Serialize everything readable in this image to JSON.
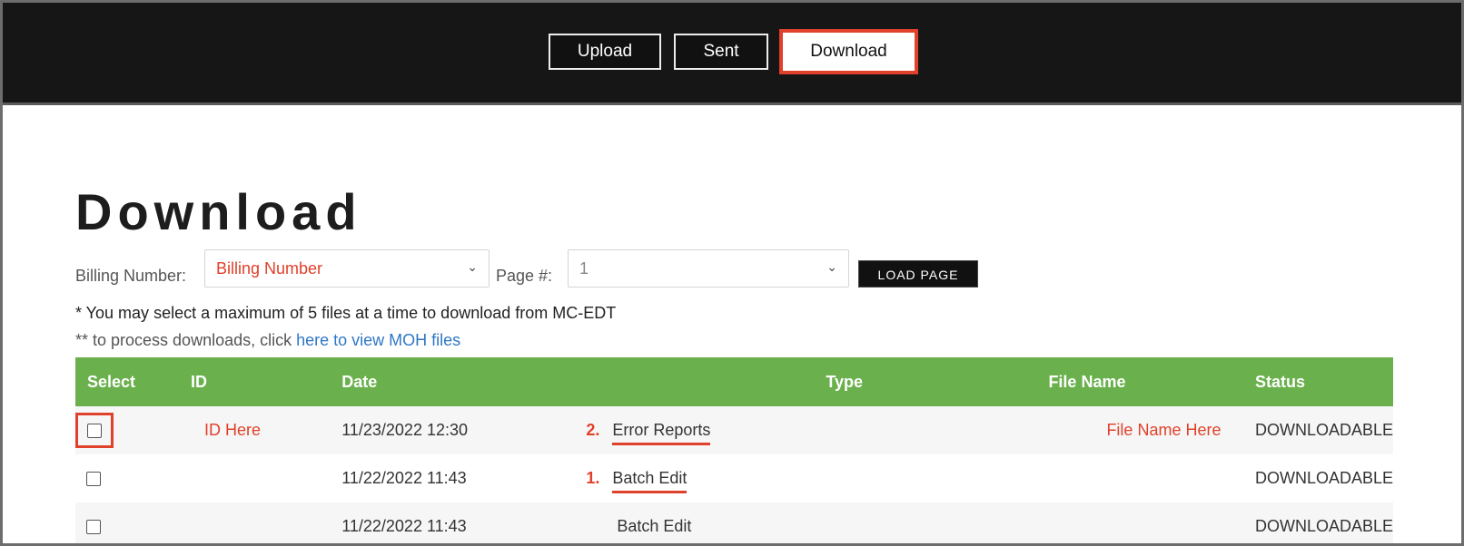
{
  "nav": {
    "upload": "Upload",
    "sent": "Sent",
    "download": "Download"
  },
  "page": {
    "title": "Download",
    "billing_label": "Billing Number:",
    "billing_value": "Billing Number",
    "page_label": "Page #:",
    "page_value": "1",
    "load_button": "LOAD PAGE",
    "note1": "* You may select a maximum of 5 files at a time to download from MC-EDT",
    "note2_prefix": "** to process downloads, click ",
    "note2_link": "here to view MOH files"
  },
  "table": {
    "headers": [
      "Select",
      "ID",
      "Date",
      "Type",
      "File Name",
      "Status"
    ],
    "rows": [
      {
        "id": "ID Here",
        "date": "11/23/2022 12:30",
        "step": "2.",
        "type": "Error Reports",
        "file": "File Name Here",
        "status": "DOWNLOADABLE"
      },
      {
        "id": "",
        "date": "11/22/2022 11:43",
        "step": "1.",
        "type": "Batch Edit",
        "file": "",
        "status": "DOWNLOADABLE"
      },
      {
        "id": "",
        "date": "11/22/2022 11:43",
        "step": "",
        "type": "Batch Edit",
        "file": "",
        "status": "DOWNLOADABLE"
      }
    ]
  },
  "colors": {
    "highlight": "#e0412b",
    "header_green": "#6ab04c",
    "link_blue": "#2f77c6"
  }
}
